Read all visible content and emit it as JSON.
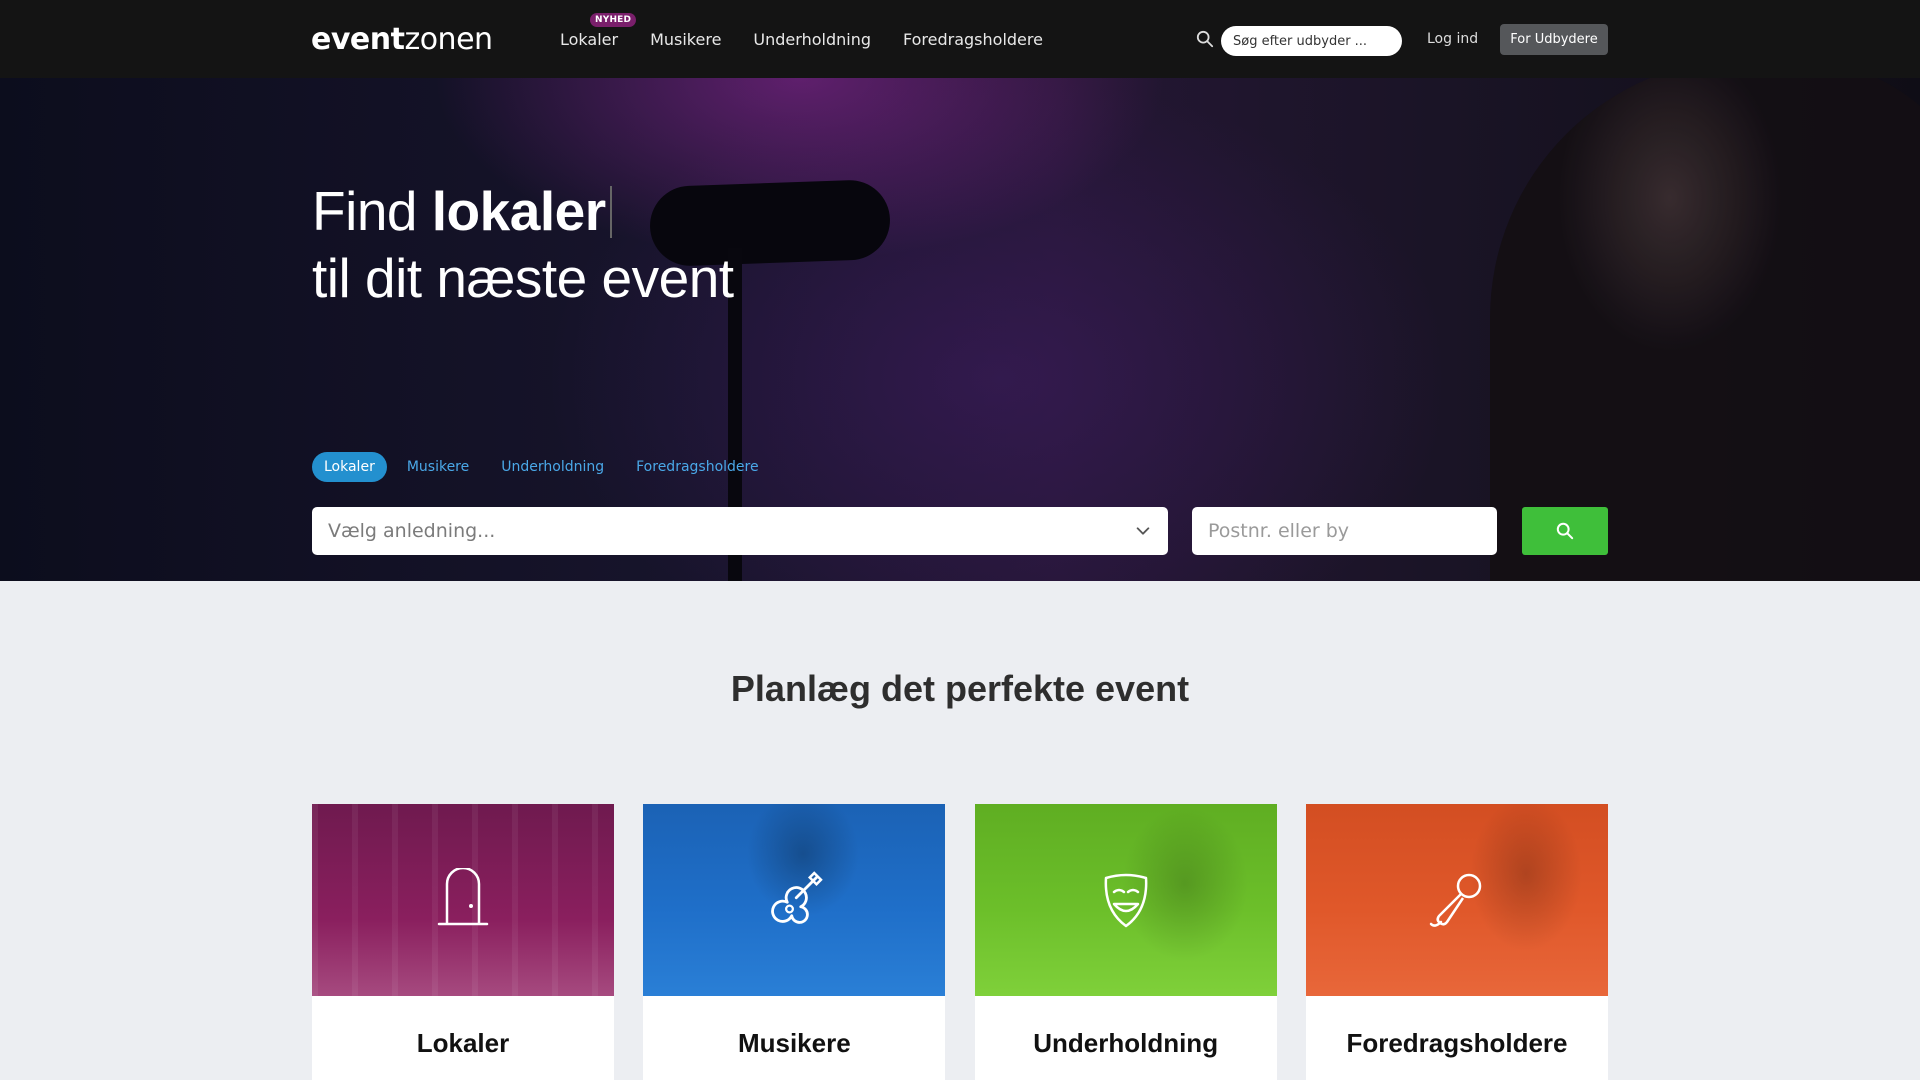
{
  "header": {
    "logo_bold": "event",
    "logo_light": "zonen",
    "nav": [
      {
        "label": "Lokaler",
        "badge": "NYHED"
      },
      {
        "label": "Musikere"
      },
      {
        "label": "Underholdning"
      },
      {
        "label": "Foredragsholdere"
      }
    ],
    "search_placeholder": "Søg efter udbyder ...",
    "login_label": "Log ind",
    "provider_label": "For Udbydere"
  },
  "hero": {
    "title_prefix": "Find",
    "title_keyword": "lokaler",
    "title_line2": "til dit næste event",
    "tabs": [
      "Lokaler",
      "Musikere",
      "Underholdning",
      "Foredragsholdere"
    ],
    "active_tab": "Lokaler",
    "occasion_placeholder": "Vælg anledning...",
    "zip_placeholder": "Postnr. eller by"
  },
  "section": {
    "title_prefix": "Planlæg det perfekte",
    "title_bold": "event"
  },
  "cards": [
    {
      "label": "Lokaler",
      "icon": "door-icon",
      "color": "#8a1f5e"
    },
    {
      "label": "Musikere",
      "icon": "guitar-icon",
      "color": "#1f6fc9"
    },
    {
      "label": "Underholdning",
      "icon": "theater-mask-icon",
      "color": "#6cbf2a"
    },
    {
      "label": "Foredragsholdere",
      "icon": "microphone-icon",
      "color": "#e0582a"
    }
  ],
  "colors": {
    "accent_blue": "#2390cf",
    "search_green": "#3fbf3a",
    "badge_purple": "#7a1f6b"
  }
}
